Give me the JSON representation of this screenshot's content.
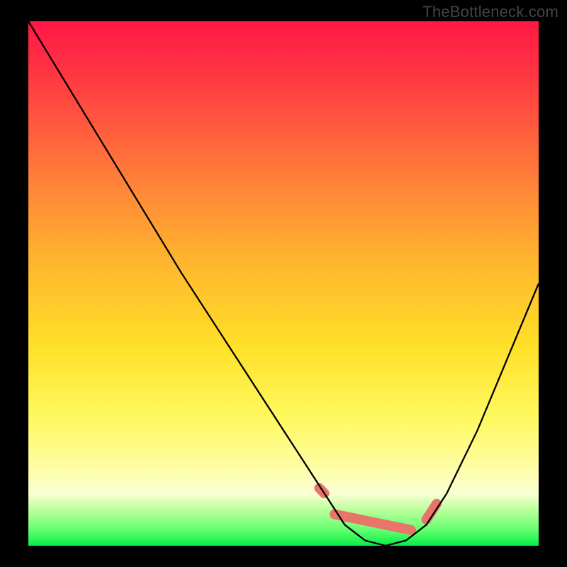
{
  "watermark": "TheBottleneck.com",
  "chart_data": {
    "type": "line",
    "title": "",
    "xlabel": "",
    "ylabel": "",
    "xlim": [
      0,
      100
    ],
    "ylim": [
      0,
      100
    ],
    "grid": false,
    "series": [
      {
        "name": "curve",
        "x": [
          0,
          10,
          20,
          30,
          40,
          50,
          58,
          62,
          66,
          70,
          74,
          78,
          82,
          88,
          94,
          100
        ],
        "values": [
          100,
          84,
          68,
          52,
          37,
          22,
          10,
          4,
          1,
          0,
          1,
          4,
          10,
          22,
          36,
          50
        ]
      }
    ],
    "markers": {
      "name": "highlight-band",
      "color": "#e8756a",
      "segments": [
        {
          "x1": 57,
          "y1": 11,
          "x2": 58,
          "y2": 10
        },
        {
          "x1": 60,
          "y1": 6,
          "x2": 75,
          "y2": 3
        },
        {
          "x1": 78,
          "y1": 5,
          "x2": 80,
          "y2": 8
        }
      ]
    },
    "background_gradient": {
      "direction": "vertical",
      "stops": [
        {
          "pos": 0.0,
          "color": "#ff1846"
        },
        {
          "pos": 0.33,
          "color": "#ff8a37"
        },
        {
          "pos": 0.62,
          "color": "#ffe028"
        },
        {
          "pos": 0.9,
          "color": "#fbffd3"
        },
        {
          "pos": 1.0,
          "color": "#07ed47"
        }
      ]
    }
  }
}
